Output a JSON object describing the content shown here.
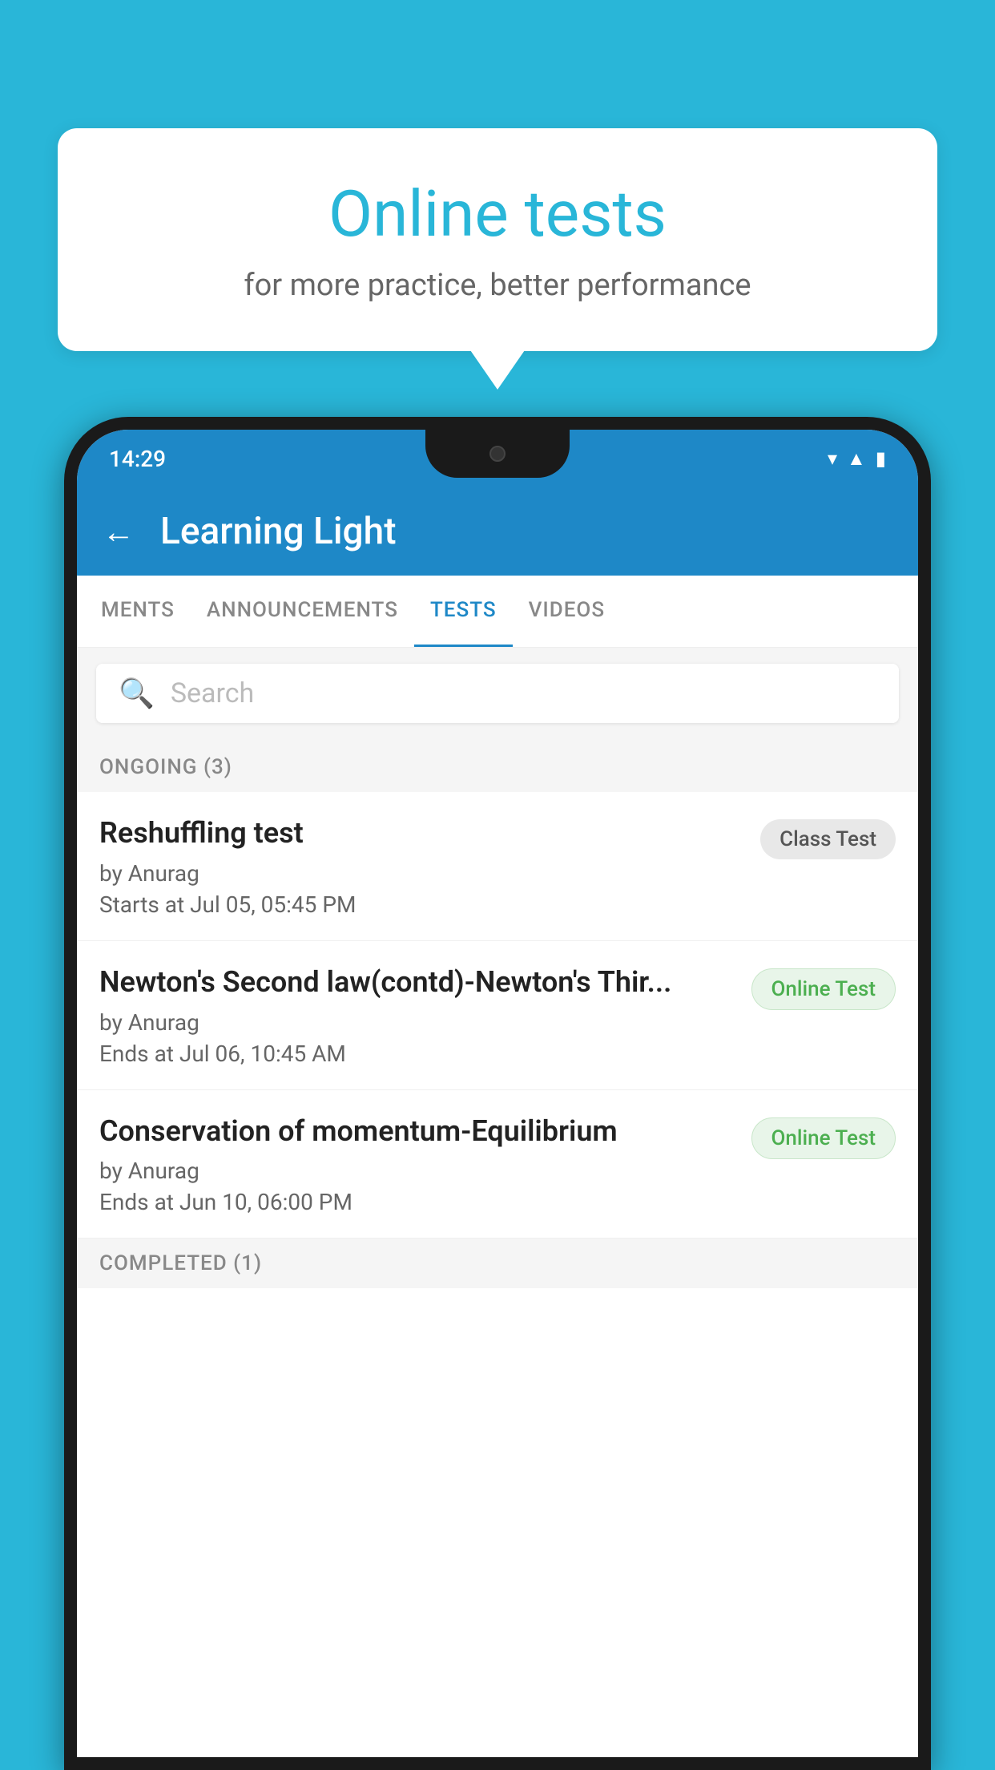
{
  "background": {
    "color": "#29B6D8"
  },
  "speech_bubble": {
    "title": "Online tests",
    "subtitle": "for more practice, better performance"
  },
  "phone": {
    "status_bar": {
      "time": "14:29",
      "icons": [
        "wifi",
        "signal",
        "battery"
      ]
    },
    "app_bar": {
      "title": "Learning Light",
      "back_label": "←"
    },
    "tabs": [
      {
        "label": "MENTS",
        "active": false
      },
      {
        "label": "ANNOUNCEMENTS",
        "active": false
      },
      {
        "label": "TESTS",
        "active": true
      },
      {
        "label": "VIDEOS",
        "active": false
      }
    ],
    "search": {
      "placeholder": "Search"
    },
    "ongoing_section": {
      "title": "ONGOING (3)"
    },
    "tests": [
      {
        "name": "Reshuffling test",
        "by": "by Anurag",
        "time": "Starts at  Jul 05, 05:45 PM",
        "badge": "Class Test",
        "badge_type": "class"
      },
      {
        "name": "Newton's Second law(contd)-Newton's Thir...",
        "by": "by Anurag",
        "time": "Ends at  Jul 06, 10:45 AM",
        "badge": "Online Test",
        "badge_type": "online"
      },
      {
        "name": "Conservation of momentum-Equilibrium",
        "by": "by Anurag",
        "time": "Ends at  Jun 10, 06:00 PM",
        "badge": "Online Test",
        "badge_type": "online"
      }
    ],
    "completed_section": {
      "title": "COMPLETED (1)"
    }
  }
}
